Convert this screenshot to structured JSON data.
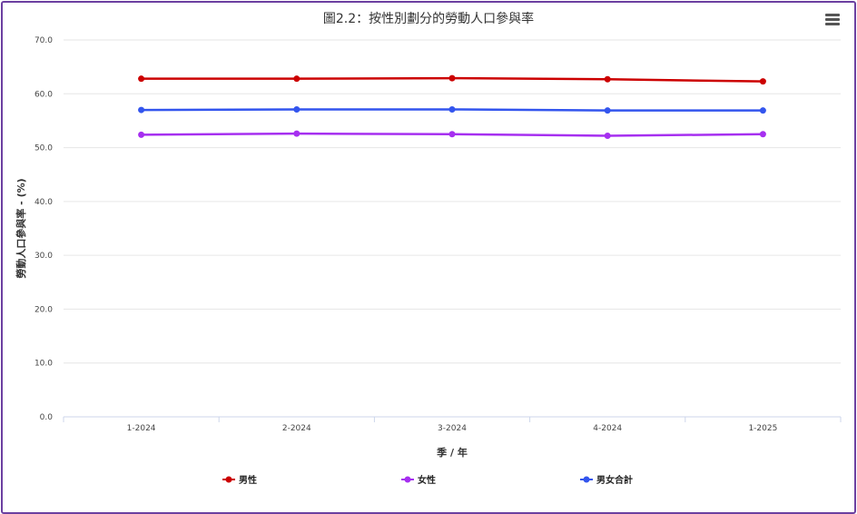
{
  "chart_title": "圖2.2：按性別劃分的勞動人口參與率",
  "menu_icon": "hamburger-menu-icon",
  "chart_data": {
    "type": "line",
    "title": "圖2.2：按性別劃分的勞動人口參與率",
    "xlabel": "季 / 年",
    "ylabel": "勞動人口參與率 - (%)",
    "categories": [
      "1-2024",
      "2-2024",
      "3-2024",
      "4-2024",
      "1-2025"
    ],
    "ylim": [
      0,
      70
    ],
    "yticks": [
      "0.0",
      "10.0",
      "20.0",
      "30.0",
      "40.0",
      "50.0",
      "60.0",
      "70.0"
    ],
    "grid": true,
    "legend_position": "bottom",
    "series": [
      {
        "name": "男性",
        "color": "#cc0000",
        "values": [
          62.8,
          62.8,
          62.9,
          62.7,
          62.3
        ]
      },
      {
        "name": "女性",
        "color": "#a62ff0",
        "values": [
          52.4,
          52.6,
          52.5,
          52.2,
          52.5
        ]
      },
      {
        "name": "男女合計",
        "color": "#3355ee",
        "values": [
          57.0,
          57.1,
          57.1,
          56.9,
          56.9
        ]
      }
    ]
  }
}
